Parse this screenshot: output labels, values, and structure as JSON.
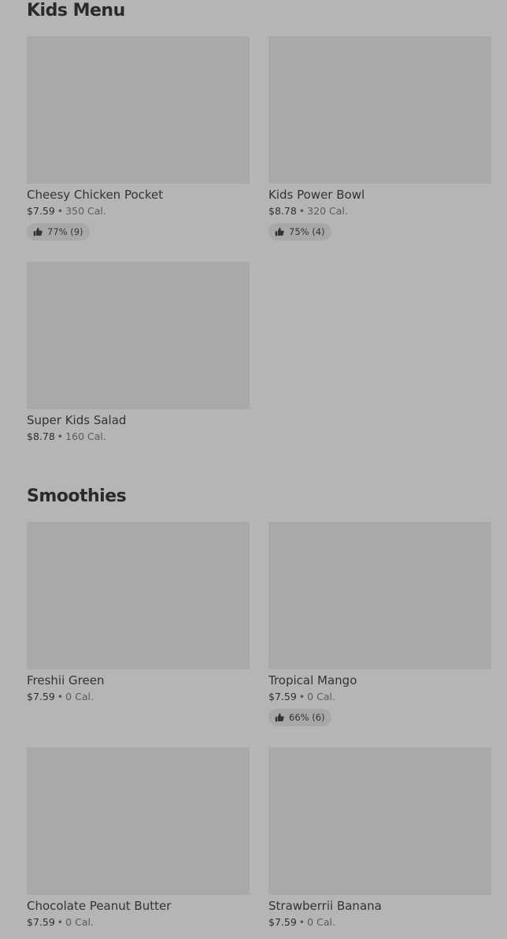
{
  "sections": [
    {
      "title": "Kids Menu",
      "items": [
        {
          "name": "Cheesy Chicken Pocket",
          "price": "$7.59",
          "calories": "350 Cal.",
          "rating": "77% (9)"
        },
        {
          "name": "Kids Power Bowl",
          "price": "$8.78",
          "calories": "320 Cal.",
          "rating": "75% (4)"
        },
        {
          "name": "Super Kids Salad",
          "price": "$8.78",
          "calories": "160 Cal.",
          "rating": null
        }
      ]
    },
    {
      "title": "Smoothies",
      "items": [
        {
          "name": "Freshii Green",
          "price": "$7.59",
          "calories": "0 Cal.",
          "rating": null
        },
        {
          "name": "Tropical Mango",
          "price": "$7.59",
          "calories": "0 Cal.",
          "rating": "66% (6)"
        },
        {
          "name": "Chocolate Peanut Butter",
          "price": "$7.59",
          "calories": "0 Cal.",
          "rating": null
        },
        {
          "name": "Strawberrii Banana",
          "price": "$7.59",
          "calories": "0 Cal.",
          "rating": null
        }
      ]
    }
  ],
  "separator": "•",
  "icons": {
    "rating": "thumbs-up-icon"
  }
}
